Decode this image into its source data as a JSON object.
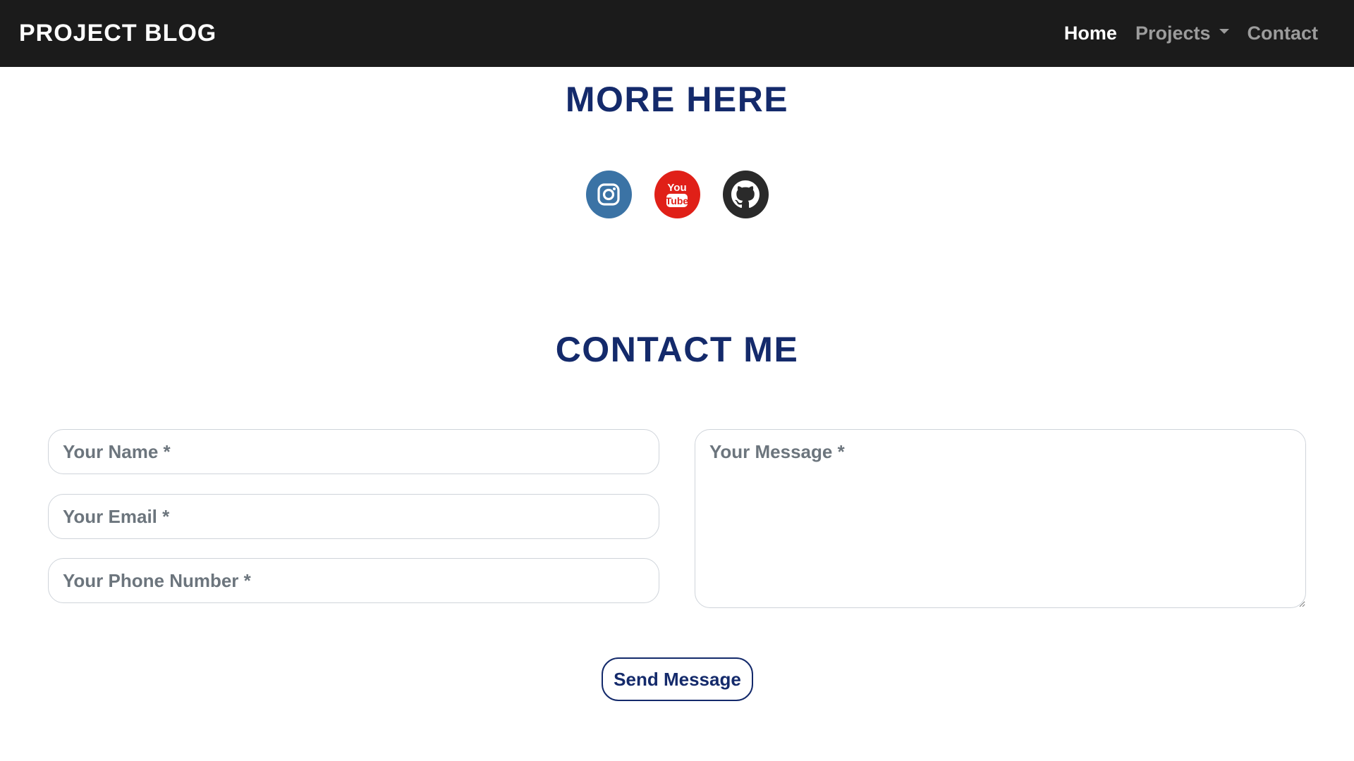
{
  "navbar": {
    "brand": "PROJECT BLOG",
    "links": [
      {
        "label": "Home",
        "active": true
      },
      {
        "label": "Projects",
        "dropdown": true
      },
      {
        "label": "Contact"
      }
    ],
    "background_color": "#1b1b1b"
  },
  "more_section": {
    "title": "MORE HERE",
    "socials": [
      {
        "name": "instagram",
        "icon": "instagram-icon",
        "color": "#3b73a5"
      },
      {
        "name": "youtube",
        "icon": "youtube-icon",
        "color": "#e02018",
        "glyph_top": "You",
        "glyph_bottom": "Tube"
      },
      {
        "name": "github",
        "icon": "github-icon",
        "color": "#2a2a2a"
      }
    ]
  },
  "contact_section": {
    "title": "CONTACT ME",
    "form": {
      "name_placeholder": "Your Name *",
      "email_placeholder": "Your Email *",
      "phone_placeholder": "Your Phone Number *",
      "message_placeholder": "Your Message *",
      "name_value": "",
      "email_value": "",
      "phone_value": "",
      "message_value": "",
      "submit_label": "Send Message"
    }
  },
  "colors": {
    "heading": "#142a6b",
    "nav_inactive": "#9c9c9c",
    "nav_active": "#ffffff"
  }
}
